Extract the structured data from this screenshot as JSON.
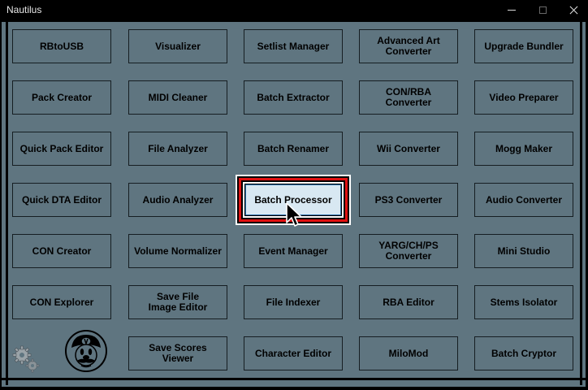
{
  "window": {
    "title": "Nautilus",
    "controls": {
      "minimize": "minimize-icon",
      "maximize": "maximize-icon",
      "close": "close-icon"
    }
  },
  "tools": [
    [
      "RBtoUSB",
      "Visualizer",
      "Setlist Manager",
      "Advanced Art\nConverter",
      "Upgrade Bundler"
    ],
    [
      "Pack Creator",
      "MIDI Cleaner",
      "Batch Extractor",
      "CON/RBA\nConverter",
      "Video Preparer"
    ],
    [
      "Quick Pack Editor",
      "File Analyzer",
      "Batch Renamer",
      "Wii Converter",
      "Mogg Maker"
    ],
    [
      "Quick DTA Editor",
      "Audio Analyzer",
      "Batch Processor",
      "PS3 Converter",
      "Audio Converter"
    ],
    [
      "CON Creator",
      "Volume Normalizer",
      "Event Manager",
      "YARG/CH/PS\nConverter",
      "Mini Studio"
    ],
    [
      "CON Explorer",
      "Save File\nImage Editor",
      "File Indexer",
      "RBA Editor",
      "Stems Isolator"
    ],
    [
      "",
      "Save Scores\nViewer",
      "Character Editor",
      "MiloMod",
      "Batch Cryptor"
    ]
  ],
  "colors": {
    "background": "#5f7580",
    "button_border": "#161e22",
    "focus_fill": "#d8e8f2",
    "highlight_red": "#e01010"
  },
  "icons": {
    "settings": "gears-icon",
    "mascot": "mario-icon",
    "pointer": "mouse-cursor-icon"
  }
}
